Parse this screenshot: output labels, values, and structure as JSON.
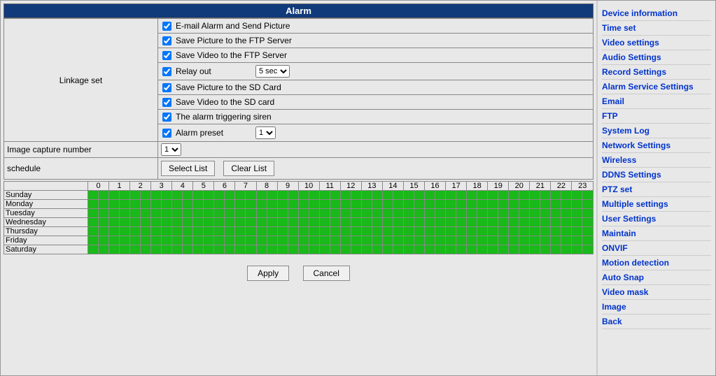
{
  "panel_title": "Alarm",
  "linkage_label": "Linkage set",
  "linkage": {
    "email": "E-mail Alarm and Send Picture",
    "ftp_picture": "Save Picture to the FTP Server",
    "ftp_video": "Save Video to the FTP Server",
    "relay_out": "Relay out",
    "relay_sec": "5 sec",
    "sd_picture": "Save Picture to the SD Card",
    "sd_video": "Save Video to the SD card",
    "siren": "The alarm triggering siren",
    "preset": "Alarm preset",
    "preset_val": "1"
  },
  "image_capture_label": "Image capture number",
  "image_capture_val": "1",
  "schedule_label": "schedule",
  "buttons": {
    "select_list": "Select List",
    "clear_list": "Clear List",
    "apply": "Apply",
    "cancel": "Cancel"
  },
  "hours": [
    "0",
    "1",
    "2",
    "3",
    "4",
    "5",
    "6",
    "7",
    "8",
    "9",
    "10",
    "11",
    "12",
    "13",
    "14",
    "15",
    "16",
    "17",
    "18",
    "19",
    "20",
    "21",
    "22",
    "23"
  ],
  "days": [
    "Sunday",
    "Monday",
    "Tuesday",
    "Wednesday",
    "Thursday",
    "Friday",
    "Saturday"
  ],
  "sidebar": [
    "Device information",
    "Time set",
    "Video settings",
    "Audio Settings",
    "Record Settings",
    "Alarm Service Settings",
    "Email",
    "FTP",
    "System Log",
    "Network Settings",
    "Wireless",
    "DDNS Settings",
    "PTZ set",
    "Multiple settings",
    "User Settings",
    "Maintain",
    "ONVIF",
    "Motion detection",
    "Auto Snap",
    "Video mask",
    "Image",
    "Back"
  ]
}
